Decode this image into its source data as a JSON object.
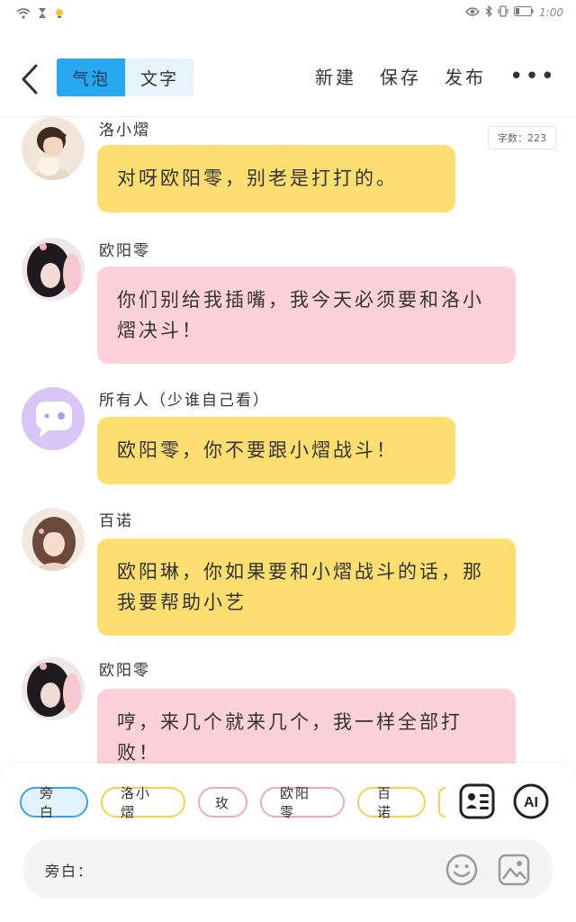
{
  "status": {
    "time": "1:00"
  },
  "header": {
    "tabs": [
      {
        "label": "气泡",
        "active": true
      },
      {
        "label": "文字",
        "active": false
      }
    ],
    "actions": [
      "新建",
      "保存",
      "发布"
    ],
    "more_label": "•••"
  },
  "word_count": "字数：223",
  "messages": [
    {
      "name": "洛小熠",
      "text": "对呀欧阳零，别老是打打的。",
      "color": "yellow",
      "avatar": "avatar-luo"
    },
    {
      "name": "欧阳零",
      "text": "你们别给我插嘴，我今天必须要和洛小熠决斗！",
      "color": "pink",
      "avatar": "avatar-ouyang"
    },
    {
      "name": "所有人（少谁自己看）",
      "text": "欧阳零，你不要跟小熠战斗！",
      "color": "yellow",
      "avatar": "chat-bubble-icon"
    },
    {
      "name": "百诺",
      "text": "欧阳琳，你如果要和小熠战斗的话，那我要帮助小艺",
      "color": "yellow",
      "avatar": "avatar-bainuo"
    },
    {
      "name": "欧阳零",
      "text": "哼，来几个就来几个，我一样全部打败！",
      "color": "pink",
      "avatar": "avatar-ouyang"
    }
  ],
  "chips": [
    {
      "label": "旁白",
      "style": "blue"
    },
    {
      "label": "洛小熠",
      "style": "yellow"
    },
    {
      "label": "玫",
      "style": "pink"
    },
    {
      "label": "欧阳零",
      "style": "pink"
    },
    {
      "label": "百诺",
      "style": "yellow"
    }
  ],
  "input": {
    "label": "旁白："
  },
  "colors": {
    "accent": "#29a8f2",
    "yellow_bubble": "#fddf71",
    "pink_bubble": "#fcd1dc"
  }
}
